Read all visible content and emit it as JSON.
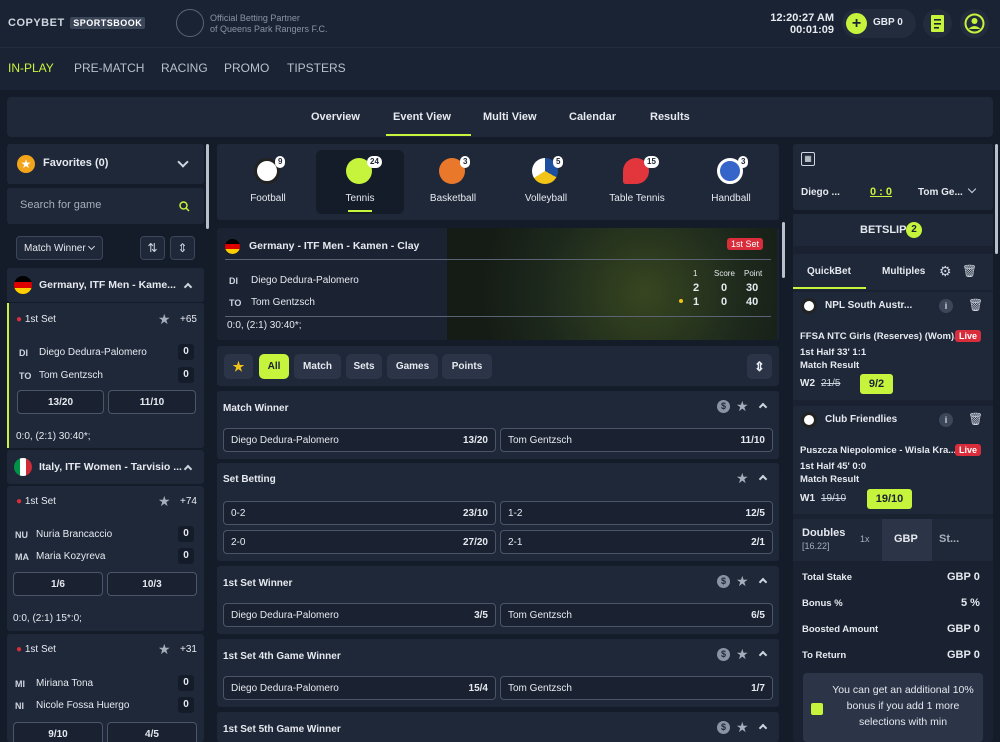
{
  "header": {
    "logo_copy": "COPYBET",
    "logo_sports": "SPORTSBOOK",
    "partner_line1": "Official Betting Partner",
    "partner_line2": "of Queens Park Rangers F.C.",
    "time": "12:20:27 AM",
    "timer": "00:01:09",
    "balance": "GBP 0",
    "colors": {
      "accent": "#c6f33c",
      "live": "#d92d3b",
      "background": "#141b29"
    }
  },
  "main_nav": [
    "IN-PLAY",
    "PRE-MATCH",
    "RACING",
    "PROMO",
    "TIPSTERS"
  ],
  "sub_nav": [
    "Overview",
    "Event View",
    "Multi View",
    "Calendar",
    "Results"
  ],
  "left": {
    "favorites_label": "Favorites (0)",
    "search_placeholder": "Search for game",
    "sort_select": "Match Winner",
    "events": [
      {
        "league": "Germany, ITF Men - Kame...",
        "set": "1st Set",
        "more": "+65",
        "p1_abbr": "DI",
        "p1": "Diego Dedura-Palomero",
        "p1_score": "0",
        "p2_abbr": "TO",
        "p2": "Tom Gentzsch",
        "p2_score": "0",
        "odd1": "13/20",
        "odd2": "11/10",
        "info": "0:0, (2:1) 30:40*;"
      },
      {
        "league": "Italy, ITF Women - Tarvisio ...",
        "set": "1st Set",
        "more": "+74",
        "p1_abbr": "NU",
        "p1": "Nuria Brancaccio",
        "p1_score": "0",
        "p2_abbr": "MA",
        "p2": "Maria Kozyreva",
        "p2_score": "0",
        "odd1": "1/6",
        "odd2": "10/3",
        "info": "0:0, (2:1) 15*:0;"
      },
      {
        "set": "1st Set",
        "more": "+31",
        "p1_abbr": "MI",
        "p1": "Miriana Tona",
        "p1_score": "0",
        "p2_abbr": "NI",
        "p2": "Nicole Fossa Huergo",
        "p2_score": "0",
        "odd1": "9/10",
        "odd2": "4/5"
      }
    ]
  },
  "sports": [
    {
      "name": "Football",
      "count": "9"
    },
    {
      "name": "Tennis",
      "count": "24"
    },
    {
      "name": "Basketball",
      "count": "3"
    },
    {
      "name": "Volleyball",
      "count": "5"
    },
    {
      "name": "Table Tennis",
      "count": "15"
    },
    {
      "name": "Handball",
      "count": "3"
    }
  ],
  "match": {
    "league": "Germany - ITF Men - Kamen - Clay",
    "badge": "1st Set",
    "p1_abbr": "DI",
    "p1": "Diego Dedura-Palomero",
    "p2_abbr": "TO",
    "p2": "Tom Gentzsch",
    "col_set": "1",
    "col_score": "Score",
    "col_point": "Point",
    "p1_set": "2",
    "p1_score": "0",
    "p1_point": "30",
    "p2_set": "1",
    "p2_score": "0",
    "p2_point": "40",
    "info": "0:0, (2:1) 30:40*;"
  },
  "filters": [
    "All",
    "Match",
    "Sets",
    "Games",
    "Points"
  ],
  "markets": [
    {
      "title": "Match Winner",
      "rows": [
        [
          {
            "l": "Diego Dedura-Palomero",
            "r": "13/20"
          },
          {
            "l": "Tom Gentzsch",
            "r": "11/10"
          }
        ]
      ]
    },
    {
      "title": "Set Betting",
      "rows": [
        [
          {
            "l": "0-2",
            "r": "23/10"
          },
          {
            "l": "1-2",
            "r": "12/5"
          }
        ],
        [
          {
            "l": "2-0",
            "r": "27/20"
          },
          {
            "l": "2-1",
            "r": "2/1"
          }
        ]
      ]
    },
    {
      "title": "1st Set Winner",
      "rows": [
        [
          {
            "l": "Diego Dedura-Palomero",
            "r": "3/5"
          },
          {
            "l": "Tom Gentzsch",
            "r": "6/5"
          }
        ]
      ]
    },
    {
      "title": "1st Set 4th Game Winner",
      "rows": [
        [
          {
            "l": "Diego Dedura-Palomero",
            "r": "15/4"
          },
          {
            "l": "Tom Gentzsch",
            "r": "1/7"
          }
        ]
      ]
    },
    {
      "title": "1st Set 5th Game Winner"
    }
  ],
  "right": {
    "mini_p1": "Diego ...",
    "mini_score": "0 : 0",
    "mini_p2": "Tom Ge...",
    "betslip": "BETSLIP",
    "betslip_count": "2",
    "tab_quickbet": "QuickBet",
    "tab_multiples": "Multiples",
    "bets": [
      {
        "league": "NPL South Austr...",
        "match": "FFSA NTC Girls (Reserves) (Wom)...",
        "live": "Live",
        "time": "1st Half 33' 1:1",
        "market": "Match Result",
        "pick": "W2",
        "old": "21/5",
        "new": "9/2"
      },
      {
        "league": "Club Friendlies",
        "match": "Puszcza Niepolomice - Wisla Kra...",
        "live": "Live",
        "time": "1st Half 45' 0:0",
        "market": "Match Result",
        "pick": "W1",
        "old": "19/10",
        "new": "19/10"
      }
    ],
    "doubles": "Doubles",
    "doubles_odds": "[16.22]",
    "mult": "1x",
    "currency": "GBP",
    "stake_tab": "St...",
    "summary": [
      {
        "label": "Total Stake",
        "value": "GBP 0"
      },
      {
        "label": "Bonus %",
        "value": "5 %"
      },
      {
        "label": "Boosted Amount",
        "value": "GBP 0"
      },
      {
        "label": "To Return",
        "value": "GBP 0"
      }
    ],
    "promo": "You can get an additional 10% bonus if you add 1 more selections with min"
  }
}
